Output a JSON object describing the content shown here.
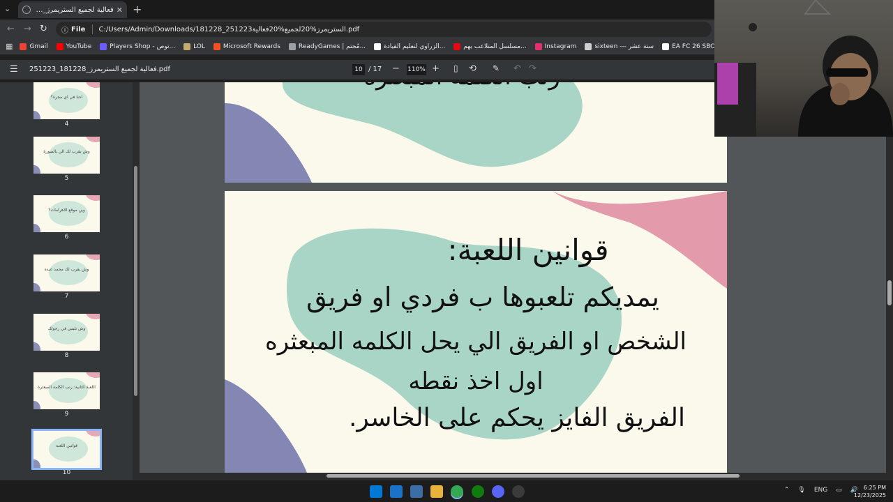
{
  "browser": {
    "tab_title": "فعالية لجميع الستريمرز_181228_251223.pdf",
    "address_label": "File",
    "url": "C:/Users/Admin/Downloads/181228_251223الستريمرز%20لجميع%20فعالية.pdf"
  },
  "bookmarks": [
    {
      "label": "Gmail",
      "color": "#ea4335"
    },
    {
      "label": "YouTube",
      "color": "#ff0000"
    },
    {
      "label": "Players Shop - توص...",
      "color": "#6b5cff"
    },
    {
      "label": "LOL",
      "color": "#c8aa6e"
    },
    {
      "label": "Microsoft Rewards",
      "color": "#f25022"
    },
    {
      "label": "ReadyGames | مُجتم...",
      "color": "#9aa0a6"
    },
    {
      "label": "الزراوي لتعليم القيادة...",
      "color": "#ffffff"
    },
    {
      "label": "مسلسل المتلاعب بهم...",
      "color": "#e50914"
    },
    {
      "label": "Instagram",
      "color": "#e1306c"
    },
    {
      "label": "sixteen --- ستة عشر",
      "color": "#cfcfcf"
    },
    {
      "label": "EA FC 26 SBC Soluti...",
      "color": "#ffffff"
    }
  ],
  "pdf": {
    "title": "فعالية لجميع الستريمرز_181228_251223.pdf",
    "current_page": "10",
    "total_pages": "/ 17",
    "zoom": "110%"
  },
  "thumbnails": [
    {
      "num": "4",
      "text": "احنا في اي مجرة؟"
    },
    {
      "num": "5",
      "text": "وش يقرب لك الي بالصورة"
    },
    {
      "num": "6",
      "text": "وين موقع الاهرامات؟"
    },
    {
      "num": "7",
      "text": "وش يقرب لك محمد عبده"
    },
    {
      "num": "8",
      "text": "وش تلبس في رجولك"
    },
    {
      "num": "9",
      "text": "اللعبة الثانية: رتب الكلمة المبعثرة"
    },
    {
      "num": "10",
      "text": "قوانين اللعبة"
    }
  ],
  "slide_top": {
    "partial_text": "رتب الكلمة المبعثرة"
  },
  "slide_main": {
    "line1": "قوانين اللعبة:",
    "line2": "يمديكم تلعبوها ب فردي او فريق",
    "line3": "الشخص او الفريق الي يحل الكلمه المبعثره",
    "line4": "اول اخذ نقطه",
    "line5": "الفريق الفايز يحكم على الخاسر."
  },
  "taskbar": {
    "language": "ENG",
    "time": "6:25 PM",
    "date": "12/23/2025"
  },
  "colors": {
    "slide_bg": "#fbf9ec",
    "blob_green": "#a9d5c6",
    "blob_pink": "#e39aaa",
    "blob_purple": "#8487b3"
  }
}
